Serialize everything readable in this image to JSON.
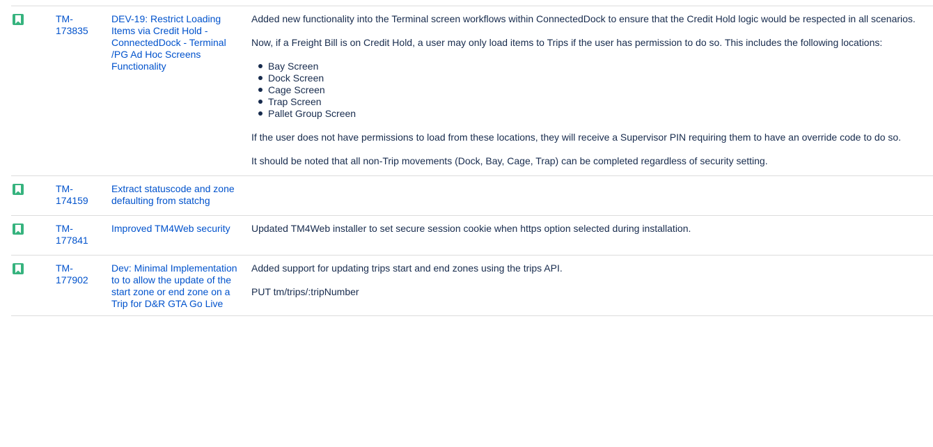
{
  "colors": {
    "story_icon": "#36b37e",
    "link": "#0052cc",
    "text": "#172b4d",
    "divider": "#dcdcdc"
  },
  "issues": [
    {
      "icon": "story-icon",
      "key_line1": "TM-",
      "key_line2": "173835",
      "summary": "DEV-19: Restrict Loading Items via Credit Hold - ConnectedDock - Terminal /PG Ad Hoc Screens Functionality",
      "paragraphs": [
        "Added new functionality into the Terminal screen workflows within ConnectedDock to ensure that the Credit Hold logic would be respected in all scenarios.",
        "Now, if a Freight Bill is on Credit Hold, a user may only load items to Trips if the user has permission to do so. This includes the following locations:"
      ],
      "list": [
        "Bay Screen",
        "Dock Screen",
        "Cage Screen",
        "Trap Screen",
        "Pallet Group Screen"
      ],
      "paragraphs_after": [
        "If the user does not have permissions to load from these locations, they will receive a Supervisor PIN requiring them to have an override code to do so.",
        "It should be noted that all non-Trip movements (Dock, Bay, Cage, Trap) can be completed regardless of security setting."
      ]
    },
    {
      "icon": "story-icon",
      "key_line1": "TM-",
      "key_line2": "174159",
      "summary": "Extract statuscode and zone defaulting from statchg",
      "paragraphs": []
    },
    {
      "icon": "story-icon",
      "key_line1": "TM-",
      "key_line2": "177841",
      "summary": "Improved TM4Web security",
      "paragraphs": [
        "Updated TM4Web installer to set secure session cookie when https option selected during installation."
      ]
    },
    {
      "icon": "story-icon",
      "key_line1": "TM-",
      "key_line2": "177902",
      "summary": "Dev: Minimal Implementation to to allow the update of the start zone or end zone on a Trip for D&R GTA Go Live",
      "paragraphs": [
        "Added support for updating trips start and end zones using the trips API.",
        "PUT tm/trips/:tripNumber"
      ]
    }
  ]
}
